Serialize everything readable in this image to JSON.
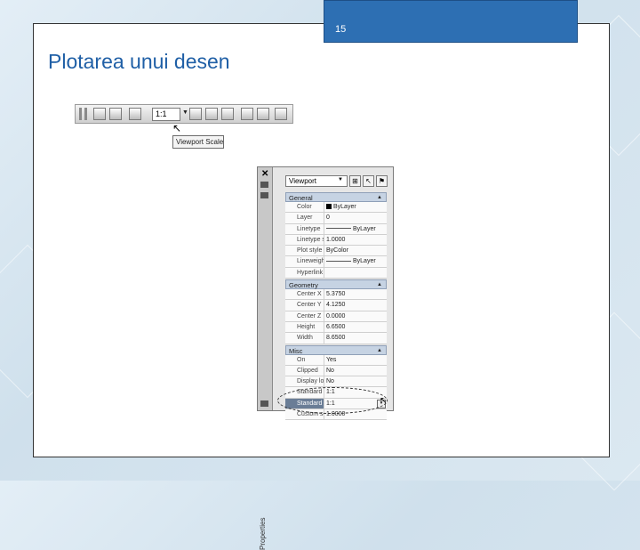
{
  "slide": {
    "page_number": "15",
    "title": "Plotarea unui desen",
    "accent_color": "#2d6fb3",
    "title_color": "#1f5fa6"
  },
  "toolbar": {
    "scale_value": "1:1",
    "tooltip": "Viewport Scale"
  },
  "palette": {
    "vertical_title": "Properties",
    "selector": "Viewport",
    "sections": [
      {
        "name": "General",
        "rows": [
          {
            "label": "Color",
            "value": "ByLayer"
          },
          {
            "label": "Layer",
            "value": "0"
          },
          {
            "label": "Linetype",
            "value": "ByLayer"
          },
          {
            "label": "Linetype sc…",
            "value": "1.0000"
          },
          {
            "label": "Plot style",
            "value": "ByColor"
          },
          {
            "label": "Lineweight",
            "value": "ByLayer"
          },
          {
            "label": "Hyperlink",
            "value": ""
          }
        ]
      },
      {
        "name": "Geometry",
        "rows": [
          {
            "label": "Center X",
            "value": "5.3750"
          },
          {
            "label": "Center Y",
            "value": "4.1250"
          },
          {
            "label": "Center Z",
            "value": "0.0000"
          },
          {
            "label": "Height",
            "value": "6.6500"
          },
          {
            "label": "Width",
            "value": "8.6500"
          }
        ]
      },
      {
        "name": "Misc",
        "rows": [
          {
            "label": "On",
            "value": "Yes"
          },
          {
            "label": "Clipped",
            "value": "No"
          },
          {
            "label": "Display loc…",
            "value": "No"
          },
          {
            "label": "Standard sc…",
            "value": "1:1"
          },
          {
            "label": "Standard sc…",
            "value": "1:1"
          },
          {
            "label": "Custom scale",
            "value": "1.0000"
          }
        ]
      }
    ]
  }
}
